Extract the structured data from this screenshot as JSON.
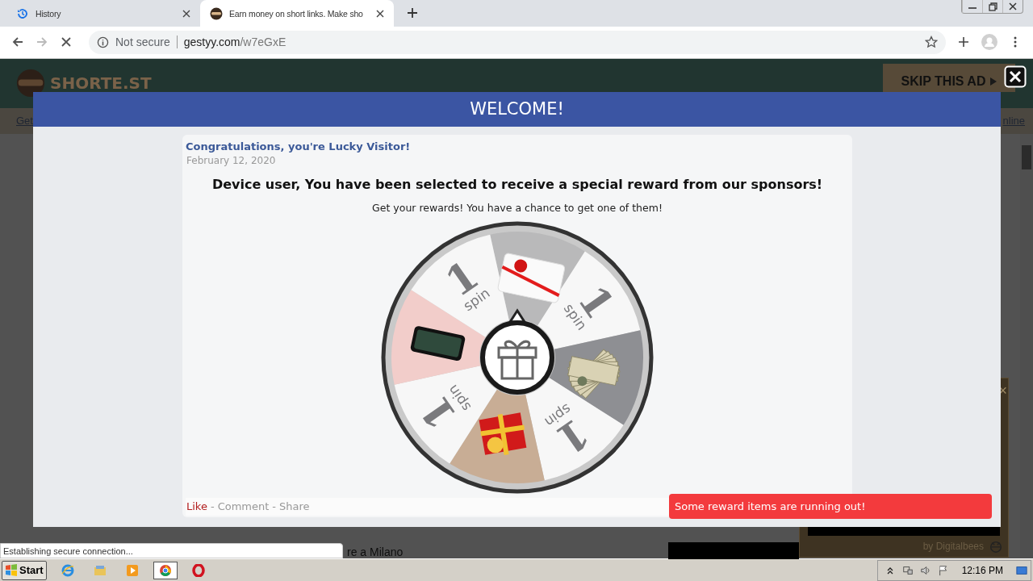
{
  "browser": {
    "tabs": [
      {
        "title": "History",
        "selected": false
      },
      {
        "title": "Earn money on short links. Make sho",
        "selected": true
      }
    ],
    "security": "Not secure",
    "domain": "gestyy.com",
    "path": "/w7eGxE",
    "loading": true
  },
  "site": {
    "logo": "SHORTE.ST",
    "skip_ad": "SKIP THIS AD",
    "nav_left": "Get",
    "nav_right": "nline",
    "content_text": "re a Milano"
  },
  "modal": {
    "title": "WELCOME!",
    "heading": "Congratulations, you're Lucky Visitor!",
    "date": "February 12, 2020",
    "headline": "Device user, You have been selected to receive a special reward from our sponsors!",
    "subtitle": "Get your rewards! You have a chance to get one of them!",
    "wheel": {
      "segments": [
        {
          "kind": "gift-card",
          "color": "#b9b9ba"
        },
        {
          "kind": "spin",
          "number": "1",
          "label": "spin",
          "color": "#f7f7f7"
        },
        {
          "kind": "money",
          "color": "#8e8f93"
        },
        {
          "kind": "spin",
          "number": "1",
          "label": "spin",
          "color": "#f7f7f7"
        },
        {
          "kind": "gift-box",
          "color": "#c8ad95"
        },
        {
          "kind": "spin",
          "number": "1",
          "label": "spin",
          "color": "#f7f7f7"
        },
        {
          "kind": "phone",
          "color": "#f2cdca"
        },
        {
          "kind": "spin",
          "number": "1",
          "label": "spin",
          "color": "#f7f7f7"
        }
      ]
    },
    "actions": [
      {
        "label": "Like",
        "kind": "primary"
      },
      {
        "label": "-",
        "kind": "separator"
      },
      {
        "label": "Comment",
        "kind": "link"
      },
      {
        "label": "-",
        "kind": "separator"
      },
      {
        "label": "Share",
        "kind": "link"
      }
    ]
  },
  "toast": "Some reward items are running out!",
  "ad": {
    "byline": "by Digitalbees",
    "close": "×"
  },
  "status": "Establishing secure connection...",
  "taskbar": {
    "start": "Start",
    "apps": [
      {
        "kind": "ie",
        "selected": false
      },
      {
        "kind": "folder",
        "selected": false
      },
      {
        "kind": "media",
        "selected": false
      },
      {
        "kind": "chrome",
        "selected": true
      },
      {
        "kind": "opera",
        "selected": false
      }
    ],
    "clock": "12:16 PM"
  }
}
